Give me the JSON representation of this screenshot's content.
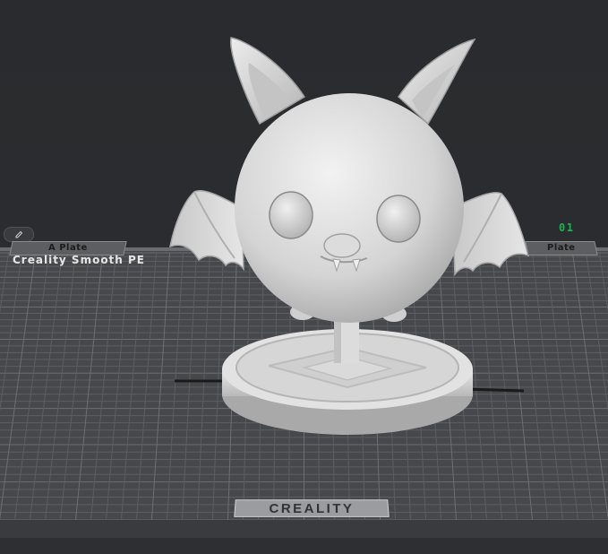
{
  "viewport": {
    "plate_tab_left": "A Plate",
    "plate_tab_right": "Plate",
    "filament_label": "Creality Smooth PE",
    "plate_number": "01",
    "brand": "CREALITY"
  },
  "colors": {
    "background": "#2a2b2e",
    "bed": "#4a4b4e",
    "grid_line": "#5f6164",
    "model": "#d9d9d9",
    "plate_number": "#11b84f"
  },
  "icons": {
    "edit": "pencil-icon"
  }
}
